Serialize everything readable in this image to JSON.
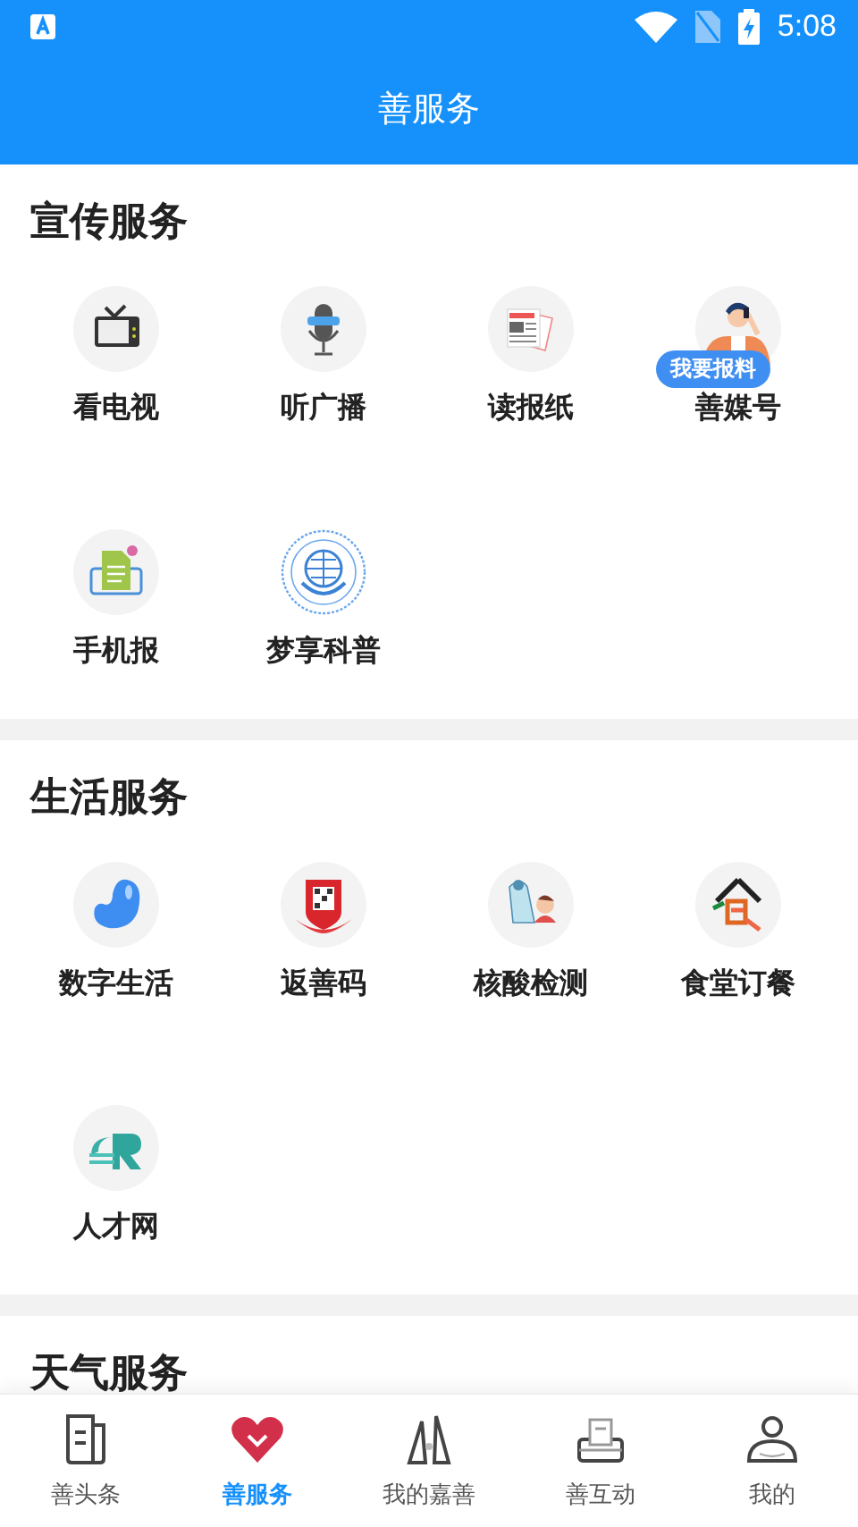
{
  "status_bar": {
    "time": "5:08"
  },
  "header": {
    "title": "善服务"
  },
  "sections": [
    {
      "title": "宣传服务",
      "items": [
        {
          "label": "看电视"
        },
        {
          "label": "听广播"
        },
        {
          "label": "读报纸"
        },
        {
          "label": "善媒号",
          "badge": "我要报料"
        },
        {
          "label": "手机报"
        },
        {
          "label": "梦享科普"
        }
      ]
    },
    {
      "title": "生活服务",
      "items": [
        {
          "label": "数字生活"
        },
        {
          "label": "返善码"
        },
        {
          "label": "核酸检测"
        },
        {
          "label": "食堂订餐"
        },
        {
          "label": "人才网"
        }
      ]
    },
    {
      "title": "天气服务"
    }
  ],
  "tab_bar": [
    {
      "label": "善头条",
      "selected": false
    },
    {
      "label": "善服务",
      "selected": true
    },
    {
      "label": "我的嘉善",
      "selected": false
    },
    {
      "label": "善互动",
      "selected": false
    },
    {
      "label": "我的",
      "selected": false
    }
  ]
}
